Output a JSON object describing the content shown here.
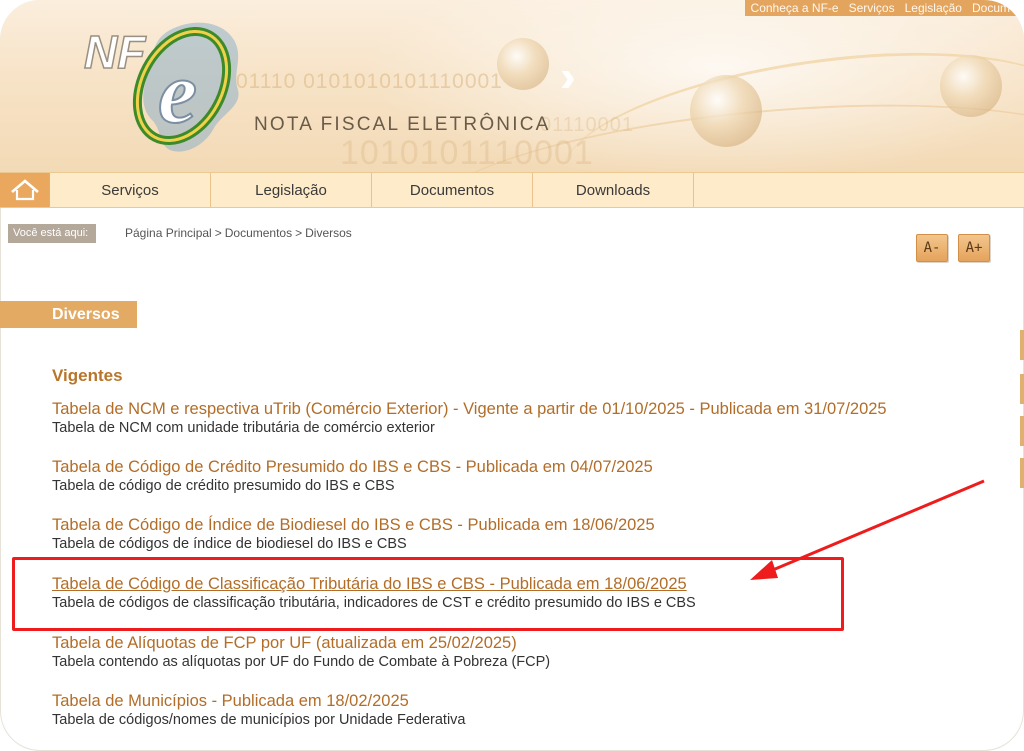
{
  "header": {
    "site_title": "NOTA FISCAL ELETRÔNICA",
    "logo_text_nf": "NF",
    "logo_text_e": "e",
    "binary_1": "01110 0101010101110001",
    "binary_2": "1010101110001",
    "binary_3": "01110001",
    "top_links": [
      "Conheça a NF-e",
      "Serviços",
      "Legislação",
      "Docum"
    ]
  },
  "nav": {
    "items": [
      {
        "label": "Serviços"
      },
      {
        "label": "Legislação"
      },
      {
        "label": "Documentos"
      },
      {
        "label": "Downloads"
      }
    ]
  },
  "breadcrumb": {
    "label": "Você está aqui:",
    "items": [
      {
        "label": "Página Principal"
      },
      {
        "label": "Documentos"
      },
      {
        "label": "Diversos"
      }
    ],
    "separator": ">"
  },
  "font_controls": {
    "decrease": "A-",
    "increase": "A+"
  },
  "section": {
    "title": "Diversos",
    "subhead": "Vigentes",
    "documents": [
      {
        "title": "Tabela de NCM e respectiva uTrib (Comércio Exterior) - Vigente a partir de 01/10/2025 - Publicada em 31/07/2025",
        "description": "Tabela de NCM com unidade tributária de comércio exterior"
      },
      {
        "title": "Tabela de Código de Crédito Presumido do IBS e CBS - Publicada em 04/07/2025",
        "description": "Tabela de código de crédito presumido do IBS e CBS"
      },
      {
        "title": "Tabela de Código de Índice de Biodiesel do IBS e CBS - Publicada em 18/06/2025",
        "description": "Tabela de códigos de índice de biodiesel do IBS e CBS"
      },
      {
        "title": "Tabela de Código de Classificação Tributária do IBS e CBS - Publicada em 18/06/2025",
        "description": "Tabela de códigos de classificação tributária, indicadores de CST e crédito presumido do IBS e CBS"
      },
      {
        "title": "Tabela de Alíquotas de FCP por UF (atualizada em 25/02/2025)",
        "description": "Tabela contendo as alíquotas por UF do Fundo de Combate à Pobreza (FCP)"
      },
      {
        "title": "Tabela de Municípios - Publicada em 18/02/2025",
        "description": "Tabela de códigos/nomes de municípios por Unidade Federativa"
      }
    ]
  },
  "colors": {
    "accent": "#e3aa63",
    "link": "#b26d28",
    "highlight": "#ee1c1c",
    "nav_bg": "#fdebc9"
  },
  "icons": {
    "home": "home-icon"
  }
}
